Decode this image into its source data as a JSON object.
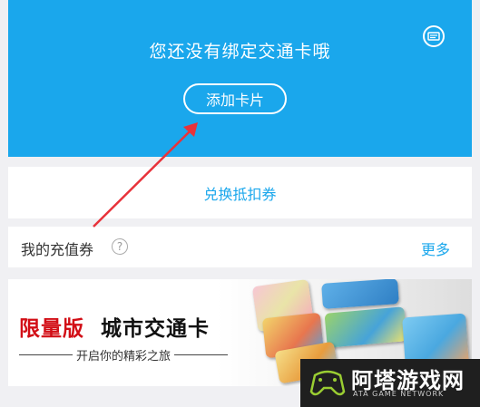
{
  "hero": {
    "title": "您还没有绑定交通卡哦",
    "add_button": "添加卡片",
    "bg_color": "#1aa7ec"
  },
  "voucher": {
    "label": "兑换抵扣券",
    "color": "#1aa7ec"
  },
  "recharge": {
    "title": "我的充值券",
    "help": "?",
    "more": "更多"
  },
  "banner": {
    "highlight": "限量版",
    "title": "城市交通卡",
    "subtitle": "开启你的精彩之旅",
    "accent_color": "#d20e16"
  },
  "watermark": {
    "name": "阿塔游戏网",
    "sub": "ATA GAME NETWORK"
  },
  "icons": [
    "card-list-icon",
    "help-icon",
    "red-arrow-annotation",
    "gamepad-logo-icon"
  ]
}
